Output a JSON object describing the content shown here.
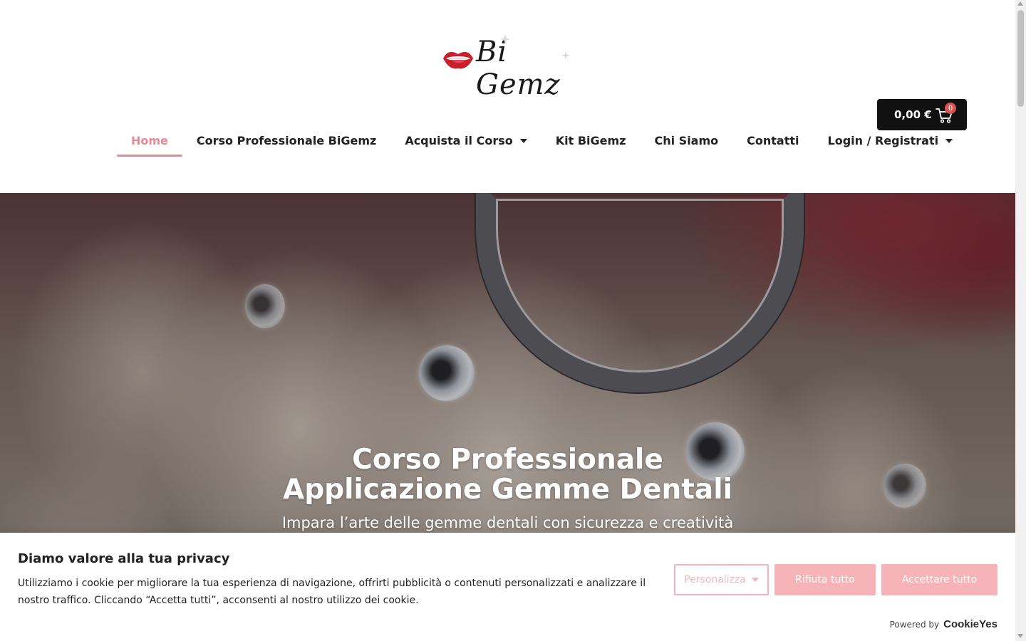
{
  "header": {
    "logo_text": "Bi Gemz",
    "cart": {
      "total": "0,00 €",
      "count": "0"
    }
  },
  "nav": {
    "items": [
      {
        "label": "Home",
        "active": true,
        "dropdown": false
      },
      {
        "label": "Corso Professionale BiGemz",
        "active": false,
        "dropdown": false
      },
      {
        "label": "Acquista il Corso",
        "active": false,
        "dropdown": true
      },
      {
        "label": "Kit BiGemz",
        "active": false,
        "dropdown": false
      },
      {
        "label": "Chi Siamo",
        "active": false,
        "dropdown": false
      },
      {
        "label": "Contatti",
        "active": false,
        "dropdown": false
      },
      {
        "label": "Login / Registrati",
        "active": false,
        "dropdown": true
      }
    ]
  },
  "hero": {
    "title_line1": "Corso Professionale",
    "title_line2": "Applicazione Gemme Dentali",
    "subtitle": "Impara l’arte delle gemme dentali con sicurezza e creatività"
  },
  "cookie_banner": {
    "title": "Diamo valore alla tua privacy",
    "text": "Utilizziamo i cookie per migliorare la tua esperienza di navigazione, offrirti pubblicità o contenuti personalizzati e analizzare il nostro traffico. Cliccando “Accetta tutti”, acconsenti al nostro utilizzo dei cookie.",
    "customize_label": "Personalizza",
    "reject_label": "Rifiuta tutto",
    "accept_label": "Accettare tutto",
    "powered_by": "Powered by",
    "powered_brand": "CookieYes"
  },
  "colors": {
    "accent": "#e88a93",
    "cookie_button": "#f7b4b8",
    "cart_bg": "#111111",
    "badge": "#d9534f"
  }
}
